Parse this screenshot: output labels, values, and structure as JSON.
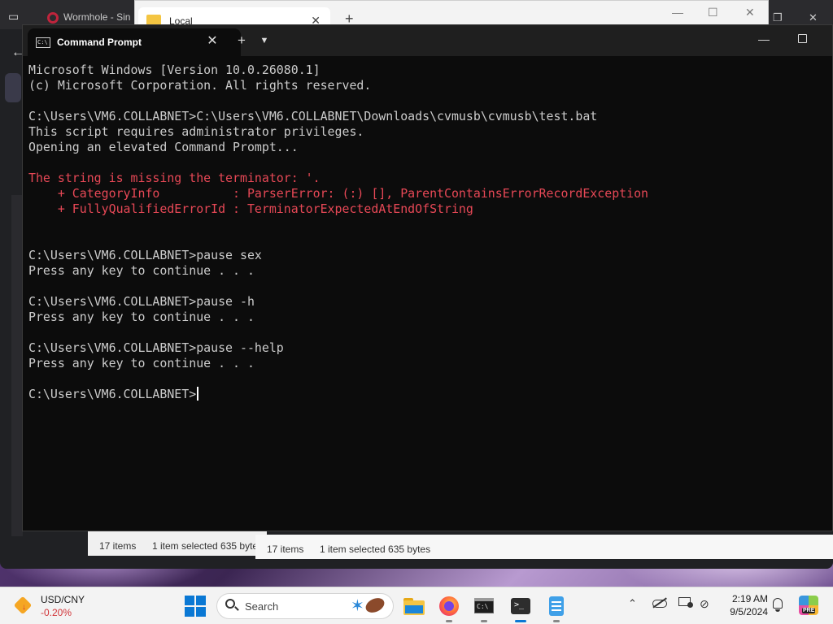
{
  "background": {
    "browser_tab": "Wormhole - Sin",
    "explorer_tab": "Local",
    "status_left": {
      "items": "17 items",
      "selected": "1 item selected  635 byte"
    },
    "status_right": {
      "items": "17 items",
      "selected": "1 item selected  635 bytes"
    }
  },
  "terminal": {
    "tab_title": "Command Prompt",
    "accent_error": "#e74856",
    "lines": [
      {
        "text": "Microsoft Windows [Version 10.0.26080.1]",
        "type": "normal"
      },
      {
        "text": "(c) Microsoft Corporation. All rights reserved.",
        "type": "normal"
      },
      {
        "text": "",
        "type": "normal"
      },
      {
        "text": "C:\\Users\\VM6.COLLABNET>C:\\Users\\VM6.COLLABNET\\Downloads\\cvmusb\\cvmusb\\test.bat",
        "type": "normal"
      },
      {
        "text": "This script requires administrator privileges.",
        "type": "normal"
      },
      {
        "text": "Opening an elevated Command Prompt...",
        "type": "normal"
      },
      {
        "text": "",
        "type": "normal"
      },
      {
        "text": "The string is missing the terminator: '.",
        "type": "error"
      },
      {
        "text": "    + CategoryInfo          : ParserError: (:) [], ParentContainsErrorRecordException",
        "type": "error"
      },
      {
        "text": "    + FullyQualifiedErrorId : TerminatorExpectedAtEndOfString",
        "type": "error"
      },
      {
        "text": "",
        "type": "normal"
      },
      {
        "text": "",
        "type": "normal"
      },
      {
        "text": "C:\\Users\\VM6.COLLABNET>pause sex",
        "type": "normal"
      },
      {
        "text": "Press any key to continue . . .",
        "type": "normal"
      },
      {
        "text": "",
        "type": "normal"
      },
      {
        "text": "C:\\Users\\VM6.COLLABNET>pause -h",
        "type": "normal"
      },
      {
        "text": "Press any key to continue . . .",
        "type": "normal"
      },
      {
        "text": "",
        "type": "normal"
      },
      {
        "text": "C:\\Users\\VM6.COLLABNET>pause --help",
        "type": "normal"
      },
      {
        "text": "Press any key to continue . . .",
        "type": "normal"
      },
      {
        "text": "",
        "type": "normal"
      }
    ],
    "prompt": "C:\\Users\\VM6.COLLABNET>"
  },
  "taskbar": {
    "widget": {
      "symbol": "USD/CNY",
      "change": "-0.20%",
      "icon": "stock-down-icon"
    },
    "search_label": "Search",
    "apps": [
      "file-explorer-icon",
      "firefox-icon",
      "command-prompt-icon",
      "terminal-icon",
      "notepad-icon"
    ],
    "clock": {
      "time": "2:19 AM",
      "date": "9/5/2024"
    }
  }
}
